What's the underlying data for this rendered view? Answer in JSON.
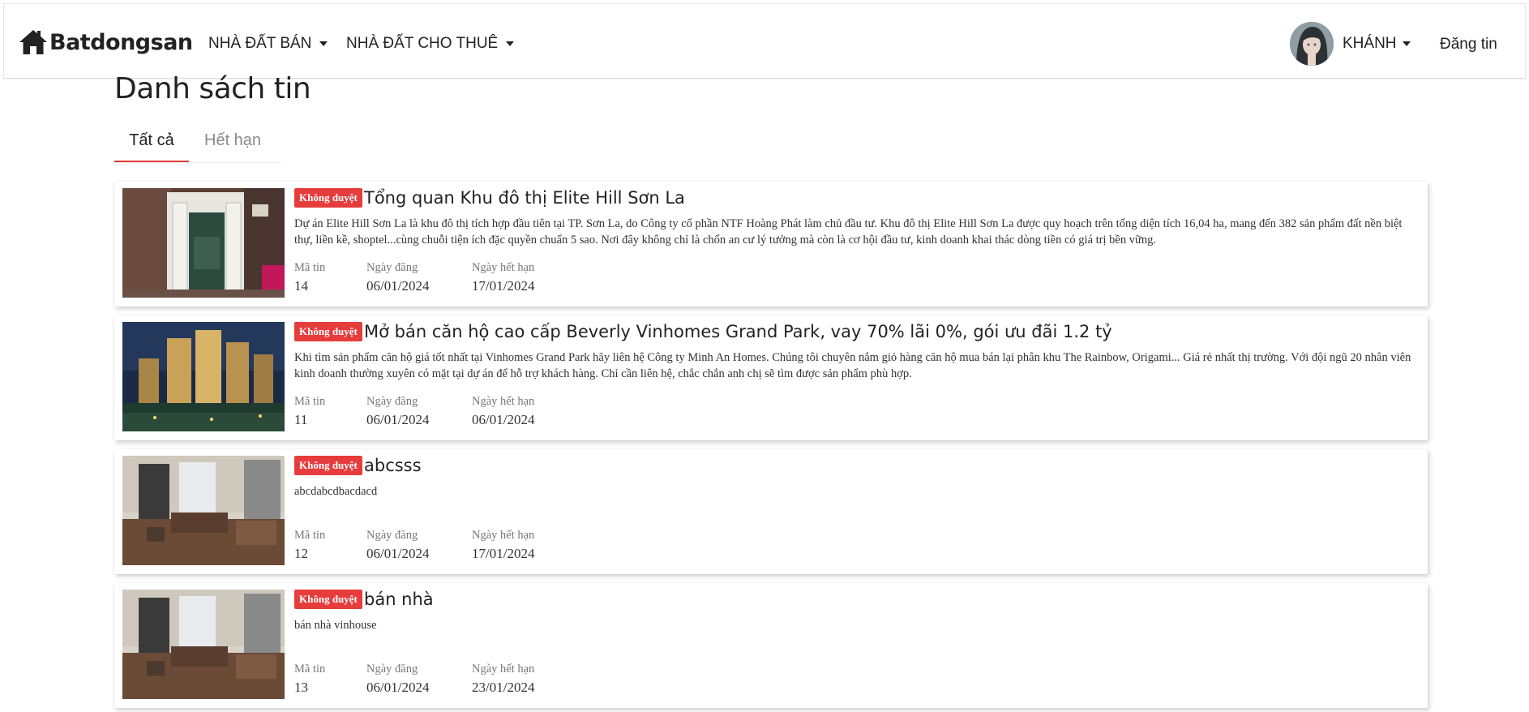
{
  "header": {
    "brand": "Batdongsan",
    "nav": [
      {
        "label": "NHÀ ĐẤT BÁN"
      },
      {
        "label": "NHÀ ĐẤT CHO THUÊ"
      }
    ],
    "user_name": "KHÁNH",
    "post_link": "Đăng tin"
  },
  "page": {
    "title": "Danh sách tin",
    "tabs": [
      {
        "label": "Tất cả",
        "active": true
      },
      {
        "label": "Hết hạn",
        "active": false
      }
    ]
  },
  "columns": {
    "id": "Mã tin",
    "posted": "Ngày đăng",
    "expires": "Ngày hết hạn"
  },
  "listings": [
    {
      "status": "Không duyệt",
      "title": "Tổng quan Khu đô thị Elite Hill Sơn La",
      "description": "Dự án Elite Hill Sơn La là khu đô thị tích hợp đầu tiên tại TP. Sơn La, do Công ty cổ phần NTF Hoàng Phát làm chủ đầu tư. Khu đô thị Elite Hill Sơn La được quy hoạch trên tổng diện tích 16,04 ha, mang đến 382 sản phẩm đất nền biệt thự, liền kề, shoptel...cùng chuỗi tiện ích đặc quyền chuẩn 5 sao. Nơi đây không chỉ là chốn an cư lý tưởng mà còn là cơ hội đầu tư, kinh doanh khai thác dòng tiền có giá trị bền vững.",
      "id": "14",
      "posted": "06/01/2024",
      "expires": "17/01/2024"
    },
    {
      "status": "Không duyệt",
      "title": "Mở bán căn hộ cao cấp Beverly Vinhomes Grand Park, vay 70% lãi 0%, gói ưu đãi 1.2 tỷ",
      "description": "Khi tìm sản phẩm căn hộ giá tốt nhất tại Vinhomes Grand Park hãy liên hệ Công ty Minh An Homes. Chúng tôi chuyên nắm giỏ hàng căn hộ mua bán lại phân khu The Rainbow, Origami... Giá rẻ nhất thị trường. Với đội ngũ 20 nhân viên kinh doanh thường xuyên có mặt tại dự án để hỗ trợ khách hàng. Chỉ cần liên hệ, chắc chắn anh chị sẽ tìm được sản phẩm phù hợp.",
      "id": "11",
      "posted": "06/01/2024",
      "expires": "06/01/2024"
    },
    {
      "status": "Không duyệt",
      "title": "abcsss",
      "description": "abcdabcdbacdacd",
      "id": "12",
      "posted": "06/01/2024",
      "expires": "17/01/2024"
    },
    {
      "status": "Không duyệt",
      "title": "bán nhà",
      "description": "bán nhà vinhouse",
      "id": "13",
      "posted": "06/01/2024",
      "expires": "23/01/2024"
    }
  ],
  "colors": {
    "accent": "#e63c3c",
    "text": "#222222",
    "muted": "#777777"
  }
}
